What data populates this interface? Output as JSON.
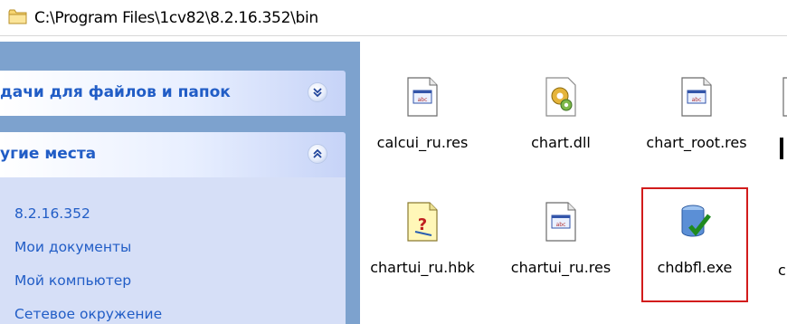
{
  "address_bar": {
    "path": "C:\\Program Files\\1cv82\\8.2.16.352\\bin",
    "folder_icon": "folder-icon"
  },
  "task_pane": {
    "panels": [
      {
        "title": "дачи для файлов и папок",
        "state": "collapsed",
        "chevron_icon": "chevron-down-icon"
      },
      {
        "title": "угие места",
        "state": "expanded",
        "chevron_icon": "chevron-up-icon",
        "links": [
          "8.2.16.352",
          "Мои документы",
          "Мой компьютер",
          "Сетевое окружение"
        ]
      }
    ]
  },
  "files": [
    {
      "name": "calcui_ru.res",
      "icon": "resource-file-icon"
    },
    {
      "name": "chart.dll",
      "icon": "dll-file-icon"
    },
    {
      "name": "chart_root.res",
      "icon": "resource-file-icon"
    },
    {
      "name": "chartui_ru.hbk",
      "icon": "help-file-icon"
    },
    {
      "name": "chartui_ru.res",
      "icon": "resource-file-icon"
    },
    {
      "name": "chdbfl.exe",
      "icon": "database-check-icon",
      "selected": true
    }
  ],
  "colors": {
    "task_pane_background": "#7da2ce",
    "task_link": "#215dc6",
    "selection_frame": "#d21c1c"
  }
}
